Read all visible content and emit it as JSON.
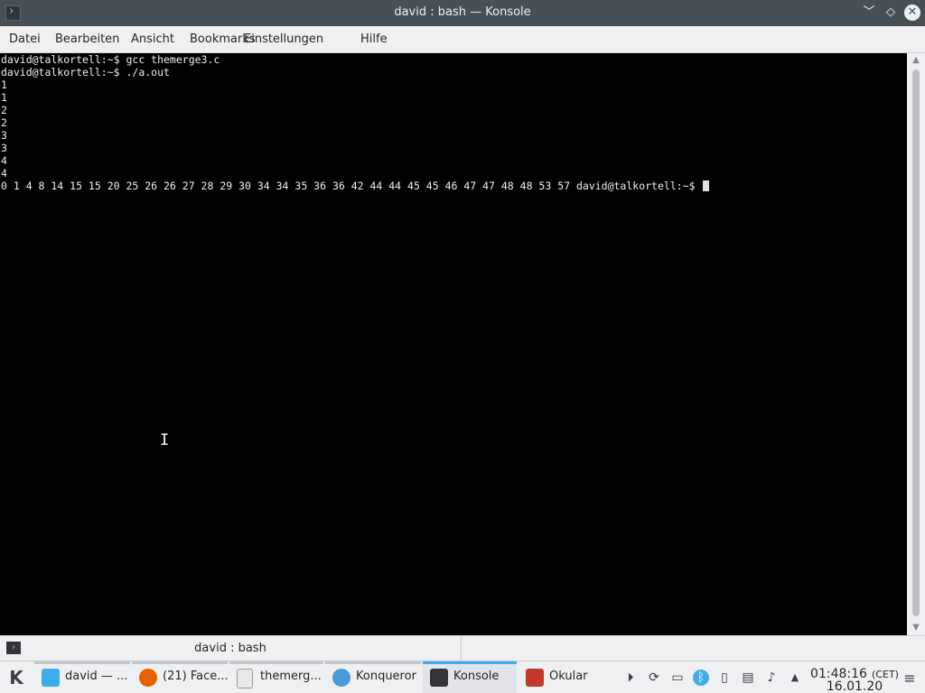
{
  "window": {
    "title": "david : bash — Konsole",
    "controls": {
      "minimize": "﹀",
      "maximize": "◇",
      "close": "✕"
    },
    "icon": "konsole-icon"
  },
  "menubar": [
    "Datei",
    "Bearbeiten",
    "Ansicht",
    "Bookmarks",
    "Einstellungen",
    "Hilfe"
  ],
  "terminal": {
    "lines": [
      "david@talkortell:~$ gcc themerge3.c",
      "david@talkortell:~$ ./a.out",
      "1",
      "1",
      "2",
      "2",
      "3",
      "3",
      "4",
      "4",
      "0 1 4 8 14 15 15 20 25 26 26 27 28 29 30 34 34 35 36 36 42 44 44 45 45 46 47 47 48 48 53 57 david@talkortell:~$ "
    ],
    "background": "#000000",
    "foreground": "#f0f0f0"
  },
  "tab": {
    "label": "david : bash"
  },
  "taskbar": {
    "tasks": [
      {
        "label": "david — ...",
        "icon": "folder-icon",
        "color": "#3daee9"
      },
      {
        "label": "(21) Face...",
        "icon": "firefox-icon",
        "color": "#e66000"
      },
      {
        "label": "themerg...",
        "icon": "text-file-icon",
        "color": "#d8d8d8"
      },
      {
        "label": "Konqueror",
        "icon": "konqueror-icon",
        "color": "#4a9ad8"
      },
      {
        "label": "Konsole",
        "icon": "konsole-icon",
        "color": "#31363b"
      },
      {
        "label": "Okular",
        "icon": "okular-icon",
        "color": "#c0392b"
      }
    ],
    "tray": [
      "media-play-icon",
      "update-icon",
      "display-icon",
      "bluetooth-icon",
      "network-icon",
      "clipboard-icon",
      "volume-icon",
      "expand-tray-icon"
    ],
    "clock": {
      "time": "01:48:16",
      "timezone": "(CET)",
      "date": "16.01.20"
    }
  },
  "accent": "#3daee9"
}
